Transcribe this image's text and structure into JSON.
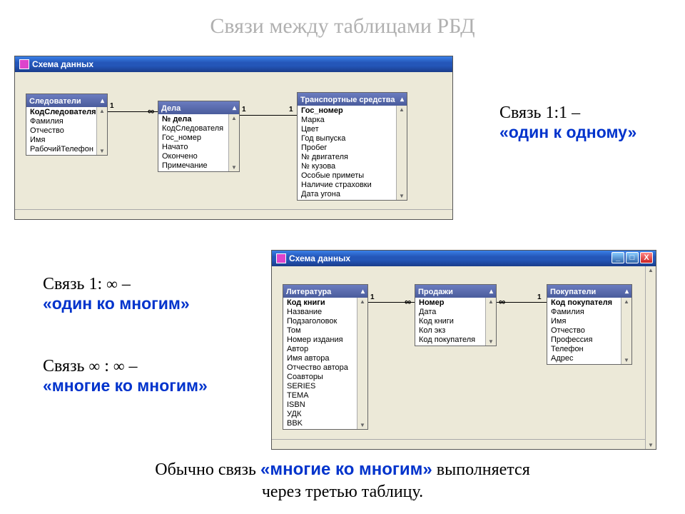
{
  "title": "Связи между таблицами РБД",
  "window1": {
    "title": "Схема данных",
    "tables": [
      {
        "name": "Следователи",
        "fields": [
          "КодСледователя",
          "Фамилия",
          "Отчество",
          "Имя",
          "РабочийТелефон"
        ],
        "pk": 0
      },
      {
        "name": "Дела",
        "fields": [
          "№ дела",
          "КодСледователя",
          "Гос_номер",
          "Начато",
          "Окончено",
          "Примечание"
        ],
        "pk": 0
      },
      {
        "name": "Транспортные средства",
        "fields": [
          "Гос_номер",
          "Марка",
          "Цвет",
          "Год выпуска",
          "Пробег",
          "№ двигателя",
          "№ кузова",
          "Особые приметы",
          "Наличие страховки",
          "Дата угона"
        ],
        "pk": 0
      }
    ],
    "rel": {
      "one": "1",
      "many": "∞"
    }
  },
  "window2": {
    "title": "Схема данных",
    "tables": [
      {
        "name": "Литература",
        "fields": [
          "Код книги",
          "Название",
          "Подзаголовок",
          "Том",
          "Номер издания",
          "Автор",
          "Имя автора",
          "Отчество автора",
          "Соавторы",
          "SERIES",
          "TEMA",
          "ISBN",
          "УДК",
          "BBK"
        ],
        "pk": 0
      },
      {
        "name": "Продажи",
        "fields": [
          "Номер",
          "Дата",
          "Код книги",
          "Кол экз",
          "Код покупателя"
        ],
        "pk": 0
      },
      {
        "name": "Покупатели",
        "fields": [
          "Код покупателя",
          "Фамилия",
          "Имя",
          "Отчество",
          "Профессия",
          "Телефон",
          "Адрес"
        ],
        "pk": 0
      }
    ],
    "rel": {
      "one": "1",
      "many": "∞"
    }
  },
  "labels": {
    "r11_a": "Связь 1:1 –",
    "r11_b": "«один к одному»",
    "r1m_a": "Связь 1: ",
    "r1m_inf": "∞",
    "r1m_dash": " –",
    "r1m_b": "«один ко многим»",
    "rmm_a": "Связь ",
    "rmm_inf1": "∞",
    "rmm_colon": " : ",
    "rmm_inf2": "∞",
    "rmm_dash": " –",
    "rmm_b": "«многие ко многим»"
  },
  "footer": {
    "a": "Обычно связь ",
    "b": "«многие ко многим»",
    "c": " выполняется",
    "d": "через третью таблицу."
  }
}
